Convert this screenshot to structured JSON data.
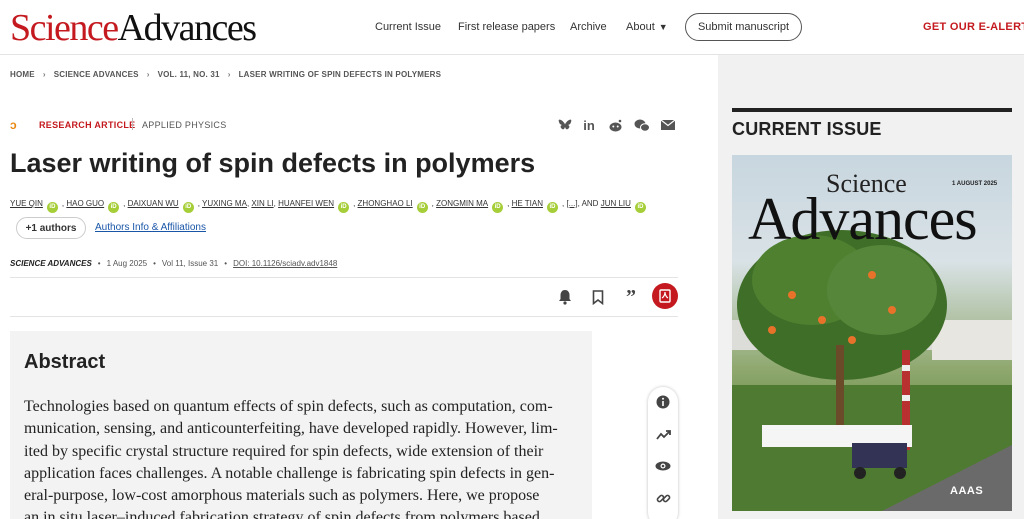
{
  "header": {
    "logo_science": "Science",
    "logo_advances": "Advances",
    "nav": [
      "Current Issue",
      "First release papers",
      "Archive",
      "About"
    ],
    "submit_label": "Submit manuscript",
    "ealerts_label": "GET OUR E-ALERTS"
  },
  "breadcrumb": [
    "HOME",
    "SCIENCE ADVANCES",
    "VOL. 11, NO. 31",
    "LASER WRITING OF SPIN DEFECTS IN POLYMERS"
  ],
  "article": {
    "type": "RESEARCH ARTICLE",
    "subject": "APPLIED PHYSICS",
    "title": "Laser writing of spin defects in polymers",
    "authors": [
      "YUE QIN",
      "HAO GUO",
      "DAIXUAN WU",
      "YUXING MA",
      "XIN LI",
      "HUANFEI WEN",
      "ZHONGHAO LI",
      "ZONGMIN MA",
      "HE TIAN",
      "JUN LIU"
    ],
    "ellipsis": "[...]",
    "and_label": ", AND",
    "plus_authors": "+1 authors",
    "affiliations_link": "Authors Info & Affiliations",
    "journal": "SCIENCE ADVANCES",
    "date": "1 Aug 2025",
    "volume": "Vol 11, Issue 31",
    "doi": "DOI: 10.1126/sciadv.adv1848"
  },
  "abstract": {
    "heading": "Abstract",
    "lines": [
      "Technologies based on quantum effects of spin defects, such as computation, com-",
      "munication, sensing, and anticounterfeiting, have developed rapidly. However, lim-",
      "ited by specific crystal structure required for spin defects, wide extension of their",
      "application faces challenges. A notable challenge is fabricating spin defects in gen-",
      "eral-purpose, low-cost amorphous materials such as polymers. Here, we propose",
      "an in situ laser–induced fabrication strategy of spin defects from polymers based"
    ]
  },
  "sidebar": {
    "current_issue_label": "CURRENT ISSUE",
    "cover_science": "Science",
    "cover_advances": "Advances",
    "cover_date": "1 AUGUST 2025",
    "cover_publisher": "AAAS"
  },
  "icons": {
    "share": [
      "bluesky-icon",
      "linkedin-icon",
      "reddit-icon",
      "wechat-icon",
      "email-icon"
    ],
    "toolbar": [
      "bell-icon",
      "bookmark-icon",
      "quote-icon",
      "pdf-icon"
    ],
    "side": [
      "info-icon",
      "metrics-icon",
      "view-icon",
      "link-icon"
    ]
  },
  "colors": {
    "brand_red": "#c41a1f",
    "orcid_green": "#a6ce39",
    "link_blue": "#1a56a8",
    "oa_orange": "#e8850f"
  }
}
